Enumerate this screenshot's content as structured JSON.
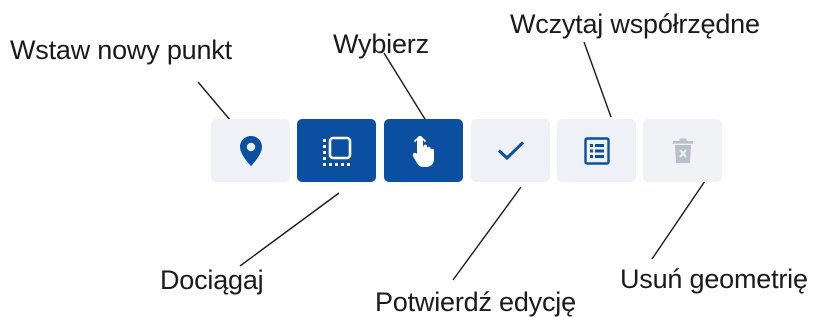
{
  "labels": {
    "insert_point": "Wstaw nowy punkt",
    "select": "Wybierz",
    "load_coordinates": "Wczytaj współrzędne",
    "snap": "Dociągaj",
    "confirm_edit": "Potwierdź edycję",
    "delete_geometry": "Usuń geometrię"
  },
  "toolbar": {
    "buttons": [
      {
        "id": "insert-point",
        "icon": "map-pin-icon",
        "state": "default"
      },
      {
        "id": "snap",
        "icon": "snap-selection-icon",
        "state": "active"
      },
      {
        "id": "select",
        "icon": "pointer-hand-icon",
        "state": "active"
      },
      {
        "id": "confirm-edit",
        "icon": "checkmark-icon",
        "state": "default"
      },
      {
        "id": "load-coordinates",
        "icon": "list-table-icon",
        "state": "default"
      },
      {
        "id": "delete-geometry",
        "icon": "trash-icon",
        "state": "disabled"
      }
    ]
  },
  "colors": {
    "accent": "#0b4fa1",
    "button_light": "#eef2f7",
    "icon_active": "#ffffff",
    "icon_default": "#0b4fa1",
    "icon_disabled": "#b9c0c8",
    "leader_line": "#1a1a1a",
    "label_text": "#1a1a1a"
  }
}
